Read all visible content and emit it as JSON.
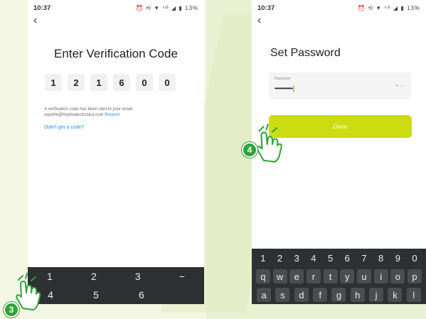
{
  "colors": {
    "accent": "#cddc11",
    "link": "#1e90ff",
    "badge": "#2fa33b"
  },
  "screen1": {
    "status": {
      "time": "10:37",
      "icons": "⏰ ⟲ ▼ ⁴ᴳ ◢ ▮ 13%"
    },
    "back_icon": "‹",
    "title": "Enter Verification Code",
    "code_digits": [
      "1",
      "2",
      "1",
      "6",
      "0",
      "0"
    ],
    "info_text": "A verification code has been sent to your email soporte@lloydselectronica.com",
    "resend": "Resend",
    "didnt_get": "Didn't get a code?",
    "keypad_row1": [
      "1",
      "2",
      "3",
      "−"
    ],
    "keypad_row2": [
      "4",
      "5",
      "6",
      ""
    ]
  },
  "screen2": {
    "status": {
      "time": "10:37",
      "icons": "⏰ ⟲ ▼ ⁴ᴳ ◢ ▮ 13%"
    },
    "back_icon": "‹",
    "title": "Set Password",
    "password_label": "Password",
    "password_value": "••••••••••••••",
    "clear_icon": "×",
    "visibility_icon": "⌣",
    "done": "Done",
    "numbers_row": [
      "1",
      "2",
      "3",
      "4",
      "5",
      "6",
      "7",
      "8",
      "9",
      "0"
    ],
    "letters_row": [
      "q",
      "w",
      "e",
      "r",
      "t",
      "y",
      "u",
      "i",
      "o",
      "p"
    ],
    "letters_row2": [
      "a",
      "s",
      "d",
      "f",
      "g",
      "h",
      "j",
      "k",
      "l"
    ]
  },
  "steps": {
    "step3": "3",
    "step4": "4"
  }
}
